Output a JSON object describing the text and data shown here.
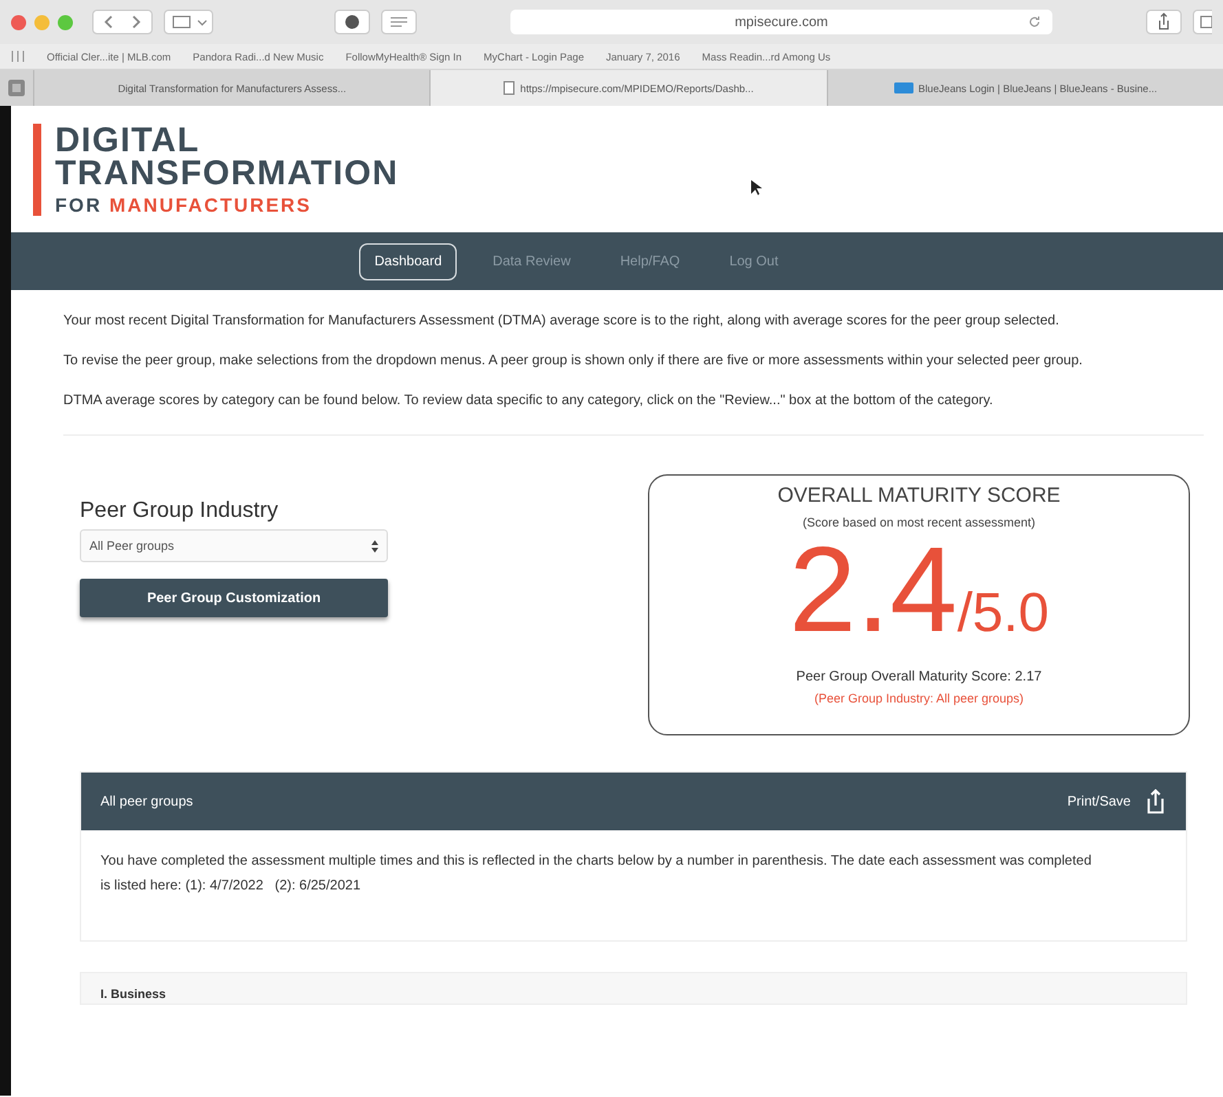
{
  "browser": {
    "address": "mpisecure.com",
    "bookmarks": [
      "Official Cler...ite | MLB.com",
      "Pandora Radi...d New Music",
      "FollowMyHealth® Sign In",
      "MyChart - Login Page",
      "January 7, 2016",
      "Mass Readin...rd Among Us"
    ],
    "tabs": [
      {
        "label": "Digital Transformation for Manufacturers Assess...",
        "selected": false
      },
      {
        "label": "https://mpisecure.com/MPIDEMO/Reports/Dashb...",
        "selected": true
      },
      {
        "label": "BlueJeans Login | BlueJeans | BlueJeans - Busine...",
        "selected": false
      }
    ]
  },
  "logo": {
    "line1": "DIGITAL",
    "line2": "TRANSFORMATION",
    "prefix": "FOR",
    "accent": "MANUFACTURERS"
  },
  "nav": [
    {
      "label": "Dashboard",
      "selected": true
    },
    {
      "label": "Data Review",
      "selected": false
    },
    {
      "label": "Help/FAQ",
      "selected": false
    },
    {
      "label": "Log Out",
      "selected": false
    }
  ],
  "intro": [
    "Your most recent Digital Transformation for Manufacturers Assessment (DTMA) average score is to the right, along with average scores for the peer group selected.",
    "To revise the peer group, make selections from the dropdown menus. A peer group is shown only if there are five or more assessments within your selected peer group.",
    "DTMA average scores by category can be found below. To review data specific to any category, click on the \"Review...\" box at the bottom of the category."
  ],
  "peer_group": {
    "label": "Peer Group Industry",
    "value": "All Peer groups",
    "button": "Peer Group Customization"
  },
  "score_card": {
    "title": "OVERALL MATURITY SCORE",
    "subtitle": "(Score based on most recent assessment)",
    "score": "2.4",
    "out_of": "/5.0",
    "peer_score": "Peer Group Overall Maturity Score: 2.17",
    "peer_note": "(Peer Group Industry: All peer groups)"
  },
  "panel": {
    "title": "All peer groups",
    "action": "Print/Save",
    "text": "You have completed the assessment multiple times and this is reflected in the charts below by a number in parenthesis. The date each assessment was completed is listed here: (1): 4/7/2022   (2): 6/25/2021"
  },
  "section": {
    "title": "I. Business"
  }
}
